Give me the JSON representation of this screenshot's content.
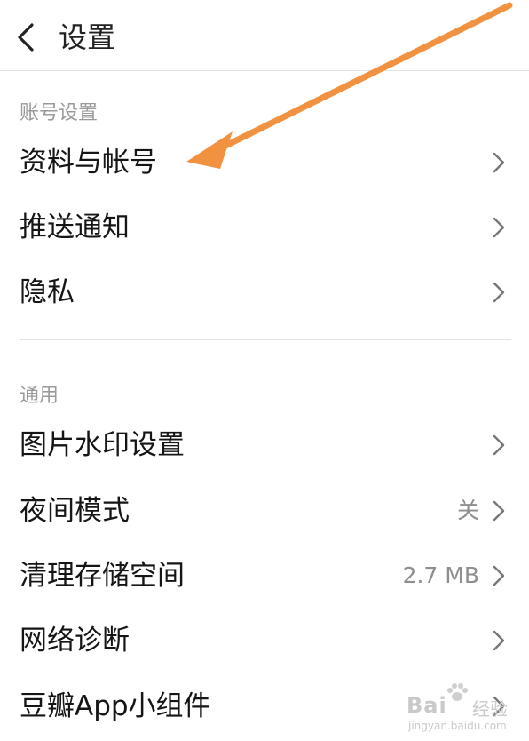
{
  "header": {
    "title": "设置"
  },
  "sections": [
    {
      "title": "账号设置",
      "items": [
        {
          "label": "资料与帐号",
          "value": ""
        },
        {
          "label": "推送通知",
          "value": ""
        },
        {
          "label": "隐私",
          "value": ""
        }
      ]
    },
    {
      "title": "通用",
      "items": [
        {
          "label": "图片水印设置",
          "value": ""
        },
        {
          "label": "夜间模式",
          "value": "关"
        },
        {
          "label": "清理存储空间",
          "value": "2.7 MB"
        },
        {
          "label": "网络诊断",
          "value": ""
        },
        {
          "label": "豆瓣App小组件",
          "value": ""
        }
      ]
    }
  ],
  "annotation": {
    "arrow_color": "#f0923f"
  },
  "watermark": {
    "brand": "Bai",
    "brand_suffix": "经验",
    "url": "jingyan.baidu.com"
  }
}
